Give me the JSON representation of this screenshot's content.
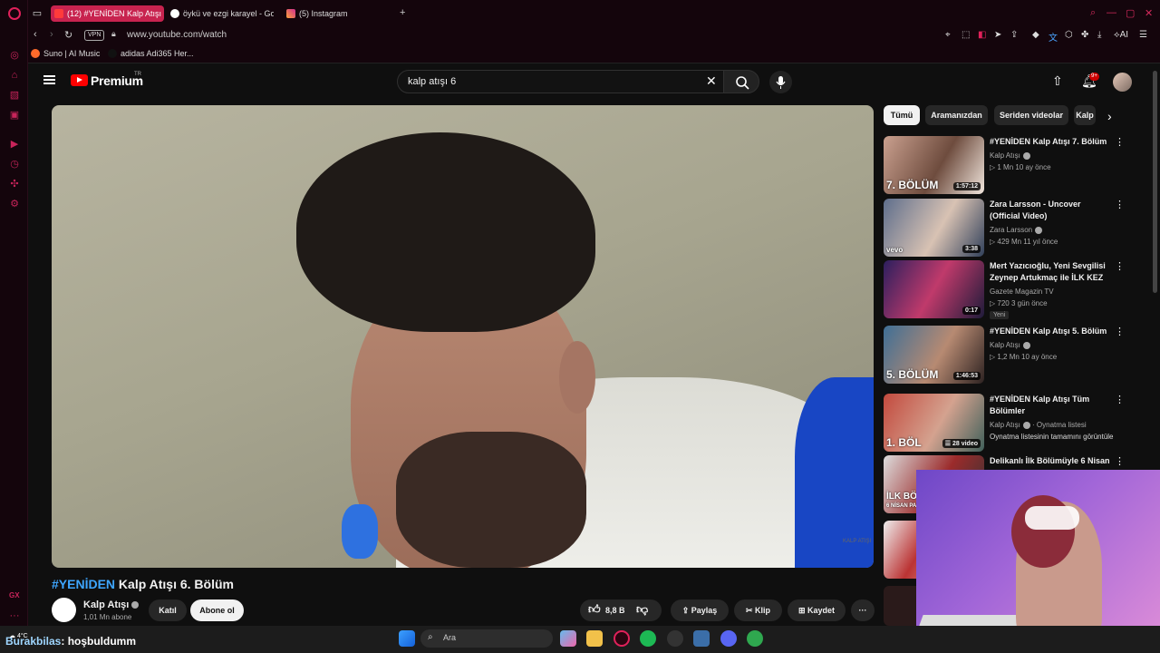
{
  "browser": {
    "tabs": [
      {
        "label": "(12) #YENİDEN Kalp Atışı 6"
      },
      {
        "label": "öykü ve ezgi karayel - Goo"
      },
      {
        "label": "(5) Instagram"
      }
    ],
    "vpn_label": "VPN",
    "url": "www.youtube.com/watch",
    "ai_label": "AI",
    "bookmarks": [
      {
        "label": "Suno | AI Music"
      },
      {
        "label": "adidas Adi365 Her..."
      }
    ]
  },
  "youtube": {
    "logo_text": "Premium",
    "region": "TR",
    "search_value": "kalp atışı 6",
    "notification_count": "9+"
  },
  "video": {
    "title_hashtag": "#YENİDEN",
    "title_rest": " Kalp Atışı 6. Bölüm",
    "watermark": "KALP ATIŞI",
    "channel_name": "Kalp Atışı",
    "subscribers": "1,01 Mn abone",
    "join_label": "Katıl",
    "subscribe_label": "Abone ol",
    "like_count": "8,8 B",
    "share_label": "Paylaş",
    "clip_label": "Klip",
    "save_label": "Kaydet"
  },
  "chips": [
    "Tümü",
    "Aramanızdan",
    "Seriden videolar",
    "Kalp"
  ],
  "recommendations": [
    {
      "title": "#YENİDEN Kalp Atışı 7. Bölüm",
      "channel": "Kalp Atışı",
      "meta": "1 Mn  10 ay önce",
      "duration": "1:57:12",
      "overlay": "7. BÖLÜM"
    },
    {
      "title": "Zara Larsson - Uncover (Official Video)",
      "channel": "Zara Larsson",
      "meta": "429 Mn  11 yıl önce",
      "duration": "3:38",
      "overlay": "vevo"
    },
    {
      "title": "Mert Yazıcıoğlu, Yeni Sevgilisi Zeynep Artukmaç ile İLK KEZ ...",
      "channel": "Gazete Magazin TV",
      "meta": "720  3 gün önce",
      "duration": "0:17",
      "badge": "Yeni"
    },
    {
      "title": "#YENİDEN Kalp Atışı 5. Bölüm",
      "channel": "Kalp Atışı",
      "meta": "1,2 Mn  10 ay önce",
      "duration": "1:46:53",
      "overlay": "5. BÖLÜM"
    },
    {
      "title": "#YENİDEN Kalp Atışı Tüm Bölümler",
      "channel": "Kalp Atışı",
      "channel_suffix": "· Oynatma listesi",
      "meta": "Oynatma listesinin tamamını görüntüle",
      "duration": "28 video",
      "overlay": "1. BÖL"
    },
    {
      "title": "Delikanlı İlk Bölümüyle 6 Nisan",
      "overlay": "İLK BÖ",
      "overlay2": "6 NİSAN PA"
    }
  ],
  "taskbar": {
    "weather": "4°C",
    "chat_user": "Burakbilas",
    "chat_text": ": hoşbuldumm",
    "search_placeholder": "Ara"
  },
  "sidebar_gx": "GX"
}
